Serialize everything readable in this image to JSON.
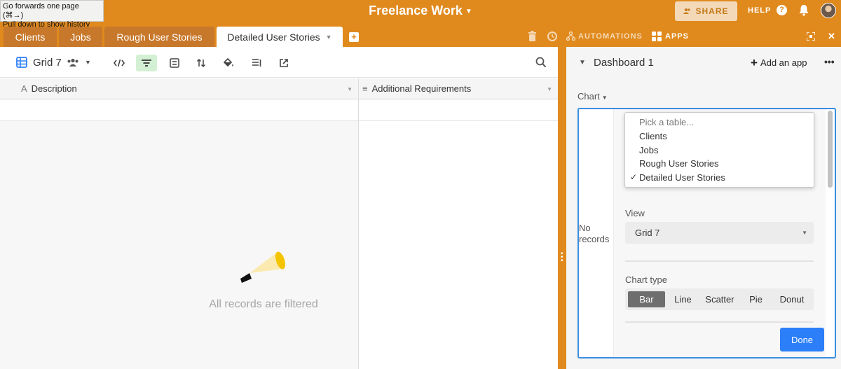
{
  "tooltip": {
    "line1": "Go forwards one page (⌘→)",
    "line2": "Pull down to show history"
  },
  "header": {
    "title": "Freelance Work",
    "share_label": "SHARE",
    "help_label": "HELP",
    "help_icon_glyph": "?"
  },
  "tabs": [
    {
      "label": "Clients",
      "active": false
    },
    {
      "label": "Jobs",
      "active": false
    },
    {
      "label": "Rough User Stories",
      "active": false
    },
    {
      "label": "Detailed User Stories",
      "active": true
    }
  ],
  "tab_actions": {
    "automations_label": "AUTOMATIONS",
    "apps_label": "APPS"
  },
  "view": {
    "name": "Grid 7"
  },
  "columns": [
    {
      "type_glyph": "A",
      "label": "Description"
    },
    {
      "type_glyph": "≡",
      "label": "Additional Requirements"
    }
  ],
  "empty_state": {
    "message": "All records are filtered"
  },
  "dashboard": {
    "title": "Dashboard 1",
    "add_app_label": "Add an app",
    "more_glyph": "•••",
    "chart_label": "Chart",
    "no_records_line1": "No",
    "no_records_line2": "records",
    "table_dropdown": {
      "placeholder": "Pick a table...",
      "options": [
        "Clients",
        "Jobs",
        "Rough User Stories",
        "Detailed User Stories"
      ],
      "selected": "Detailed User Stories",
      "check_glyph": "✓"
    },
    "view_label": "View",
    "view_value": "Grid 7",
    "chart_type_label": "Chart type",
    "chart_types": [
      "Bar",
      "Line",
      "Scatter",
      "Pie",
      "Donut"
    ],
    "chart_type_selected": "Bar",
    "done_label": "Done"
  },
  "colors": {
    "brand_orange": "#e08a1e",
    "accent_blue": "#2d7ff9",
    "filter_active_bg": "#d4f0d4"
  }
}
